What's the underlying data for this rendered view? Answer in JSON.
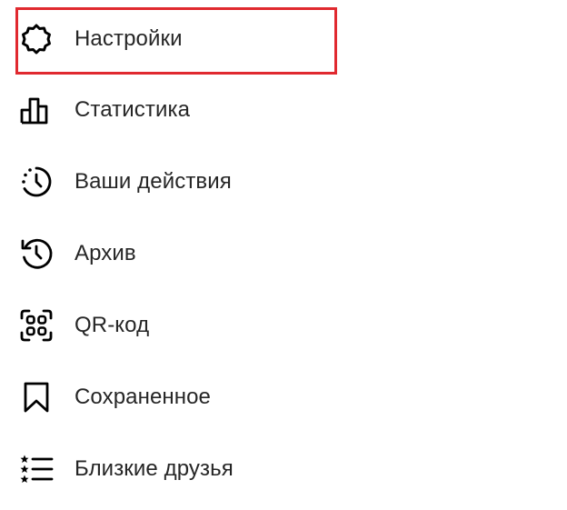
{
  "menu": {
    "items": [
      {
        "label": "Настройки",
        "icon": "gear-icon"
      },
      {
        "label": "Статистика",
        "icon": "bar-chart-icon"
      },
      {
        "label": "Ваши действия",
        "icon": "activity-clock-icon"
      },
      {
        "label": "Архив",
        "icon": "archive-history-icon"
      },
      {
        "label": "QR-код",
        "icon": "qr-code-icon"
      },
      {
        "label": "Сохраненное",
        "icon": "bookmark-icon"
      },
      {
        "label": "Близкие друзья",
        "icon": "close-friends-list-icon"
      }
    ]
  },
  "colors": {
    "highlight": "#e0292f",
    "text": "#262626",
    "icon": "#000000"
  }
}
